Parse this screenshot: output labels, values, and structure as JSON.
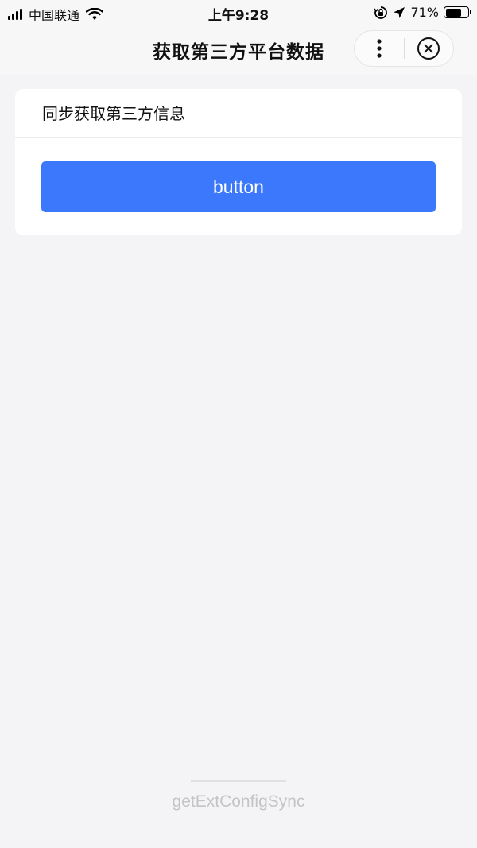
{
  "status_bar": {
    "carrier": "中国联通",
    "time": "上午9:28",
    "battery_percent": "71%",
    "battery_level": 0.71,
    "icons": [
      "signal-icon",
      "wifi-icon",
      "rotation-lock-icon",
      "location-arrow-icon",
      "battery-icon"
    ]
  },
  "nav": {
    "title": "获取第三方平台数据",
    "more_icon": "more-dots-icon",
    "close_icon": "close-circle-icon"
  },
  "card": {
    "title": "同步获取第三方信息",
    "button_label": "button"
  },
  "footer": {
    "api_name": "getExtConfigSync"
  },
  "colors": {
    "primary": "#3b78fb",
    "background": "#f4f3f6",
    "footer_text": "#c4c4c4"
  }
}
